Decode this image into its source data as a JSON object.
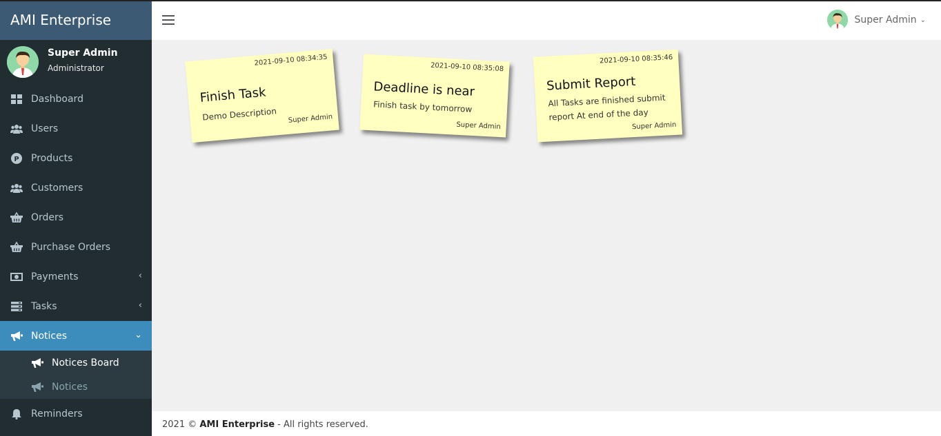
{
  "app": {
    "brand": "AMI Enterprise"
  },
  "sidebar": {
    "user": {
      "name": "Super Admin",
      "role": "Administrator"
    },
    "items": [
      {
        "label": "Dashboard",
        "icon": "dashboard-icon"
      },
      {
        "label": "Users",
        "icon": "users-icon"
      },
      {
        "label": "Products",
        "icon": "product-icon"
      },
      {
        "label": "Customers",
        "icon": "customers-icon"
      },
      {
        "label": "Orders",
        "icon": "basket-icon"
      },
      {
        "label": "Purchase Orders",
        "icon": "basket-icon"
      },
      {
        "label": "Payments",
        "icon": "money-icon"
      },
      {
        "label": "Tasks",
        "icon": "tasks-icon"
      },
      {
        "label": "Notices",
        "icon": "megaphone-icon"
      },
      {
        "label": "Reminders",
        "icon": "bell-icon"
      }
    ],
    "notices_sub": [
      {
        "label": "Notices Board"
      },
      {
        "label": "Notices"
      }
    ]
  },
  "header": {
    "user_name": "Super Admin"
  },
  "notes": [
    {
      "date": "2021-09-10 08:34:35",
      "title": "Finish Task",
      "description": "Demo Description",
      "author": "Super Admin"
    },
    {
      "date": "2021-09-10 08:35:08",
      "title": "Deadline is near",
      "description": "Finish task by tomorrow",
      "author": "Super Admin"
    },
    {
      "date": "2021-09-10 08:35:46",
      "title": "Submit Report",
      "description": "All Tasks are finished submit report At end of the day",
      "author": "Super Admin"
    }
  ],
  "footer": {
    "year": "2021 ©",
    "company": "AMI Enterprise",
    "rights": "- All rights reserved."
  },
  "colors": {
    "sidebar_bg": "#222d32",
    "active_bg": "#3c8dbc",
    "note_bg": "#ffffc0"
  }
}
